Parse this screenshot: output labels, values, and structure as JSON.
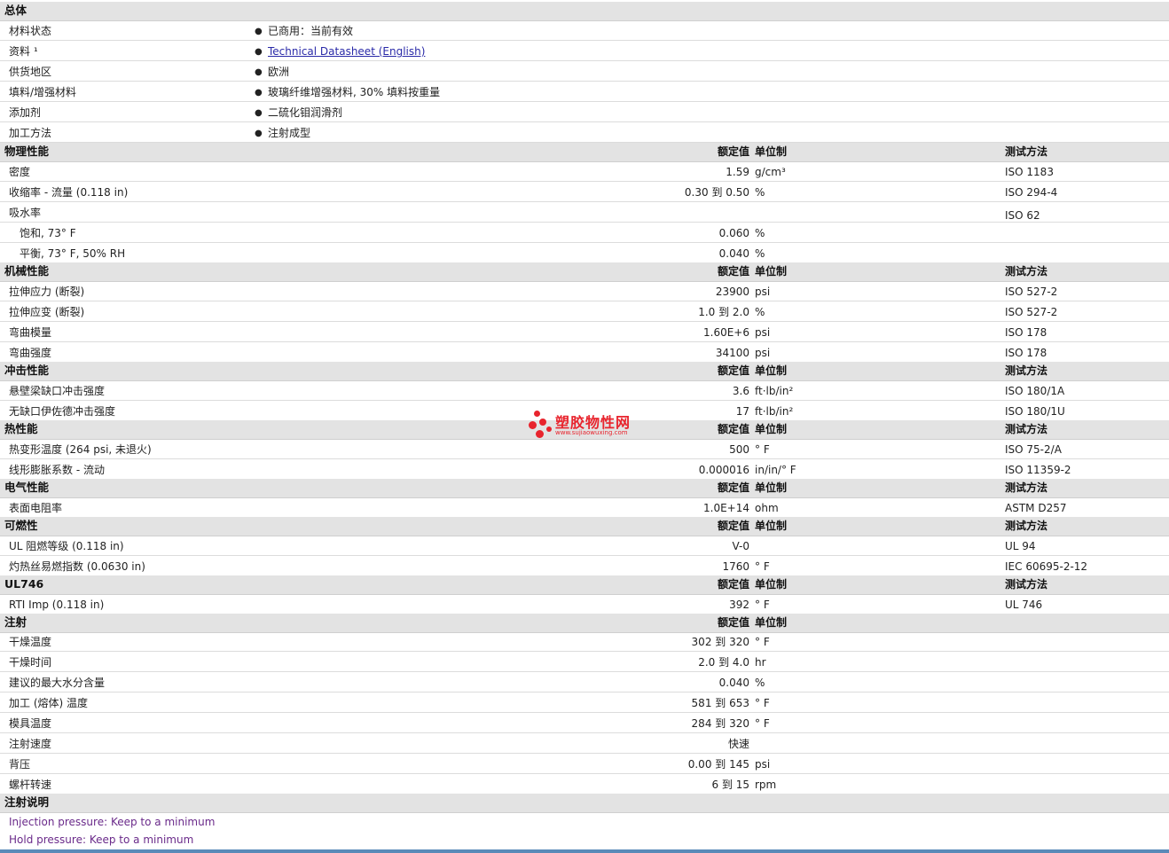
{
  "general": {
    "title": "总体",
    "rows": [
      {
        "label": "材料状态",
        "value": "已商用：当前有效"
      },
      {
        "label": "资料 ¹",
        "value": "Technical Datasheet (English)"
      },
      {
        "label": "供货地区",
        "value": "欧洲"
      },
      {
        "label": "填料/增强材料",
        "value": "玻璃纤维增强材料, 30% 填料按重量"
      },
      {
        "label": "添加剂",
        "value": "二硫化钼润滑剂"
      },
      {
        "label": "加工方法",
        "value": "注射成型"
      }
    ]
  },
  "headers": {
    "value": "额定值",
    "unit": "单位制",
    "method": "测试方法"
  },
  "physical": {
    "title": "物理性能",
    "rows": [
      {
        "label": "密度",
        "value": "1.59",
        "unit": "g/cm³",
        "method": "ISO 1183"
      },
      {
        "label": "收缩率 - 流量 (0.118 in)",
        "value": "0.30 到 0.50",
        "unit": "%",
        "method": "ISO 294-4"
      },
      {
        "label": "吸水率",
        "value": "",
        "unit": "",
        "method": "ISO 62"
      },
      {
        "label": "饱和, 73° F",
        "value": "0.060",
        "unit": "%",
        "method": ""
      },
      {
        "label": "平衡, 73° F, 50% RH",
        "value": "0.040",
        "unit": "%",
        "method": ""
      }
    ]
  },
  "mechanical": {
    "title": "机械性能",
    "rows": [
      {
        "label": "拉伸应力 (断裂)",
        "value": "23900",
        "unit": "psi",
        "method": "ISO 527-2"
      },
      {
        "label": "拉伸应变 (断裂)",
        "value": "1.0 到 2.0",
        "unit": "%",
        "method": "ISO 527-2"
      },
      {
        "label": "弯曲模量",
        "value": "1.60E+6",
        "unit": "psi",
        "method": "ISO 178"
      },
      {
        "label": "弯曲强度",
        "value": "34100",
        "unit": "psi",
        "method": "ISO 178"
      }
    ]
  },
  "impact": {
    "title": "冲击性能",
    "rows": [
      {
        "label": "悬壁梁缺口冲击强度",
        "value": "3.6",
        "unit": "ft·lb/in²",
        "method": "ISO 180/1A"
      },
      {
        "label": "无缺口伊佐德冲击强度",
        "value": "17",
        "unit": "ft·lb/in²",
        "method": "ISO 180/1U"
      }
    ]
  },
  "thermal": {
    "title": "热性能",
    "rows": [
      {
        "label": "热变形温度 (264 psi, 未退火)",
        "value": "500",
        "unit": "° F",
        "method": "ISO 75-2/A"
      },
      {
        "label": "线形膨胀系数 - 流动",
        "value": "0.000016",
        "unit": "in/in/° F",
        "method": "ISO 11359-2"
      }
    ]
  },
  "electrical": {
    "title": "电气性能",
    "rows": [
      {
        "label": "表面电阻率",
        "value": "1.0E+14",
        "unit": "ohm",
        "method": "ASTM D257"
      }
    ]
  },
  "flammability": {
    "title": "可燃性",
    "rows": [
      {
        "label": "UL 阻燃等级 (0.118 in)",
        "value": "V-0",
        "unit": "",
        "method": "UL 94"
      },
      {
        "label": "灼热丝易燃指数 (0.0630 in)",
        "value": "1760",
        "unit": "° F",
        "method": "IEC 60695-2-12"
      }
    ]
  },
  "ul746": {
    "title": "UL746",
    "rows": [
      {
        "label": "RTI Imp (0.118 in)",
        "value": "392",
        "unit": "° F",
        "method": "UL 746"
      }
    ]
  },
  "injection": {
    "title": "注射",
    "rows": [
      {
        "label": "干燥温度",
        "value": "302 到 320",
        "unit": "° F"
      },
      {
        "label": "干燥时间",
        "value": "2.0 到 4.0",
        "unit": "hr"
      },
      {
        "label": "建议的最大水分含量",
        "value": "0.040",
        "unit": "%"
      },
      {
        "label": "加工 (熔体) 温度",
        "value": "581 到 653",
        "unit": "° F"
      },
      {
        "label": "模具温度",
        "value": "284 到 320",
        "unit": "° F"
      },
      {
        "label": "注射速度",
        "value": "快速",
        "unit": ""
      },
      {
        "label": "背压",
        "value": "0.00 到 145",
        "unit": "psi"
      },
      {
        "label": "螺杆转速",
        "value": "6 到 15",
        "unit": "rpm"
      }
    ]
  },
  "notes": {
    "title": "注射说明",
    "lines": [
      "Injection pressure: Keep to a minimum",
      "Hold pressure: Keep to a minimum"
    ]
  },
  "watermark": {
    "name": "塑胶物性网",
    "url": "www.sujiaowuxing.com",
    "color": "#e8242d"
  }
}
